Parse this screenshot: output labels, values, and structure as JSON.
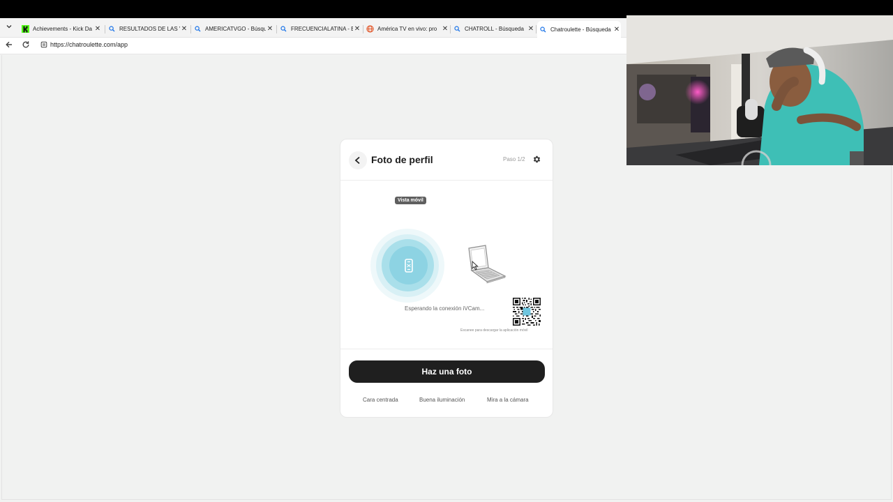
{
  "browser": {
    "tabs": [
      {
        "title": "Achievements - Kick Da",
        "icon": "kick-icon",
        "active": false
      },
      {
        "title": "RESULTADOS DE LAS VO",
        "icon": "search-icon",
        "active": false
      },
      {
        "title": "AMERICATVGO - Búsque",
        "icon": "search-icon",
        "active": false
      },
      {
        "title": "FRECUENCIALATINA - B",
        "icon": "search-icon",
        "active": false
      },
      {
        "title": "América TV en vivo: pro",
        "icon": "globe-icon",
        "active": false
      },
      {
        "title": "CHATROLL - Búsqueda",
        "icon": "search-icon",
        "active": false
      },
      {
        "title": "Chatroulette - Búsqueda",
        "icon": "search-icon",
        "active": true
      }
    ],
    "url": "https://chatroulette.com/app",
    "accent": "#2a63d5"
  },
  "card": {
    "title": "Foto de perfil",
    "step": "Paso 1/2",
    "badge": "Vista móvil",
    "waiting_text": "Esperando la conexión iVCam...",
    "scan_text": "Escanee para descargar la aplicación móvil",
    "photo_button": "Haz una foto",
    "tips": [
      "Cara centrada",
      "Buena iluminación",
      "Mira a la cámara"
    ],
    "accent": "#8dd3e3"
  }
}
